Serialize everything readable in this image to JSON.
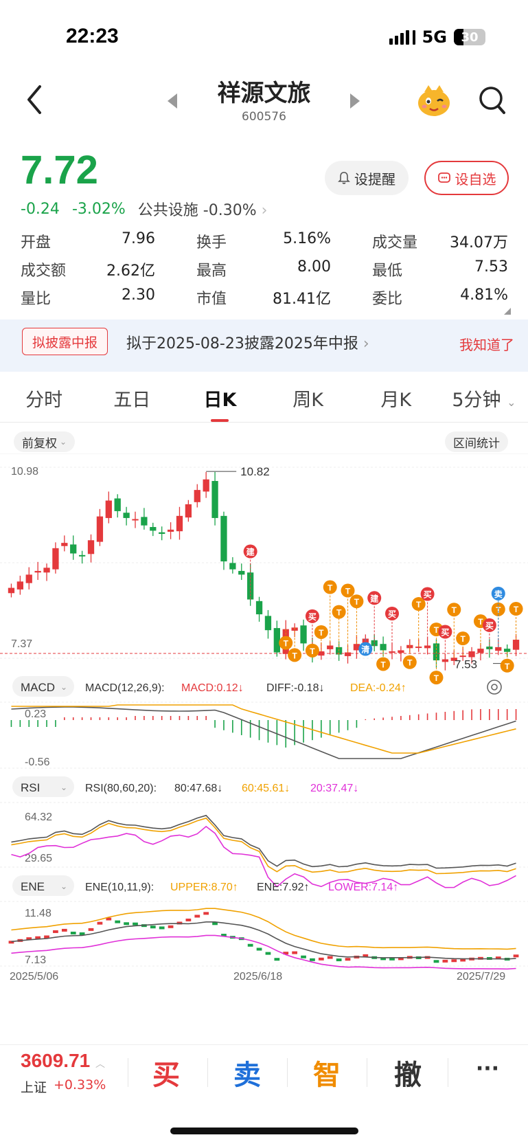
{
  "status": {
    "time": "22:23",
    "network": "5G",
    "battery": "30"
  },
  "header": {
    "title": "祥源文旅",
    "code": "600576"
  },
  "quote": {
    "price": "7.72",
    "change": "-0.24",
    "change_pct": "-3.02%",
    "sector": "公共设施",
    "sector_pct": "-0.30%",
    "alert_label": "设提醒",
    "watch_label": "设自选"
  },
  "stats": [
    [
      {
        "k": "开盘",
        "v": "7.96",
        "c": ""
      },
      {
        "k": "换手",
        "v": "5.16%",
        "c": ""
      },
      {
        "k": "成交量",
        "v": "34.07万",
        "c": ""
      }
    ],
    [
      {
        "k": "成交额",
        "v": "2.62亿",
        "c": ""
      },
      {
        "k": "最高",
        "v": "8.00",
        "c": "red"
      },
      {
        "k": "最低",
        "v": "7.53",
        "c": "green"
      }
    ],
    [
      {
        "k": "量比",
        "v": "2.30",
        "c": ""
      },
      {
        "k": "市值",
        "v": "81.41亿",
        "c": ""
      },
      {
        "k": "委比",
        "v": "4.81%",
        "c": "red"
      }
    ]
  ],
  "notice": {
    "badge": "拟披露中报",
    "text": "拟于2025-08-23披露2025年中报",
    "dismiss": "我知道了"
  },
  "tabs": [
    "分时",
    "五日",
    "日K",
    "周K",
    "月K",
    "5分钟"
  ],
  "chart_controls": {
    "adjust": "前复权",
    "range_stats": "区间统计"
  },
  "colors": {
    "up": "#e4393c",
    "down": "#1aa34a",
    "macd": "#e4393c",
    "diff": "#555555",
    "dea": "#f0a100",
    "rsi80": "#555555",
    "rsi60": "#f0a100",
    "rsi20": "#e030d8"
  },
  "chart_data": {
    "type": "candlestick",
    "main": {
      "ymax_label": "10.98",
      "ymin_label": "7.37",
      "high_mark": "10.82",
      "low_mark": "7.53"
    },
    "x_labels": [
      "2025/5/06",
      "2025/6/18",
      "2025/7/29"
    ],
    "closes": [
      8.7,
      8.82,
      8.95,
      9.02,
      9.08,
      9.45,
      9.55,
      9.35,
      9.3,
      9.6,
      10.05,
      10.35,
      10.15,
      10.02,
      10.0,
      9.88,
      9.78,
      9.72,
      9.8,
      10.06,
      10.28,
      10.55,
      10.75,
      10.02,
      9.2,
      9.05,
      8.95,
      8.48,
      8.2,
      7.9,
      7.48,
      7.92,
      7.95,
      7.65,
      7.45,
      7.5,
      7.61,
      7.44,
      7.48,
      7.64,
      7.74,
      7.6,
      7.52,
      7.5,
      7.52,
      7.62,
      7.59,
      7.61,
      7.33,
      7.35,
      7.38,
      7.42,
      7.5,
      7.55,
      7.54,
      7.58,
      7.49,
      7.72
    ],
    "macd": {
      "label": "MACD",
      "params": "MACD(12,26,9):",
      "macd_v": "MACD:0.12↓",
      "diff_v": "DIFF:-0.18↓",
      "dea_v": "DEA:-0.24↑",
      "ymax_label": "0.23",
      "ymin_label": "-0.56"
    },
    "rsi": {
      "label": "RSI",
      "params": "RSI(80,60,20):",
      "r80": "80:47.68↓",
      "r60": "60:45.61↓",
      "r20": "20:37.47↓",
      "ymax_label": "64.32",
      "ymin_label": "29.65"
    },
    "ene": {
      "label": "ENE",
      "params": "ENE(10,11,9):",
      "upper": "UPPER:8.70↑",
      "mid": "ENE:7.92↑",
      "lower": "LOWER:7.14↑",
      "ymax_label": "11.48",
      "ymin_label": "7.13"
    },
    "markers": {
      "build": "建",
      "buy": "买",
      "sell": "卖",
      "clear": "清",
      "t": "T"
    }
  },
  "bottom": {
    "index_value": "3609.71",
    "index_name": "上证",
    "index_change": "+0.33%",
    "buy": "买",
    "sell": "卖",
    "smart": "智",
    "cancel": "撤",
    "more": "···"
  }
}
